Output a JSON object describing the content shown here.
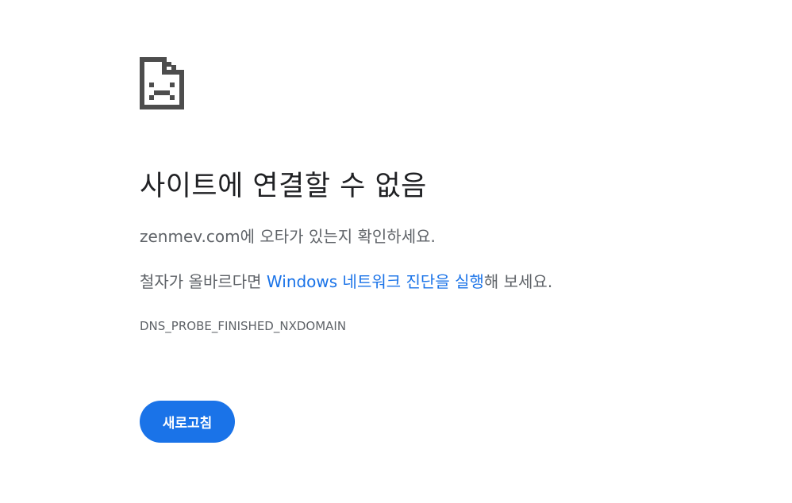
{
  "error": {
    "icon": "sad-page-icon",
    "title": "사이트에 연결할 수 없음",
    "domain": "zenmev.com",
    "domain_suffix": "에 오타가 있는지 확인하세요.",
    "hint_prefix": "철자가 올바르다면 ",
    "hint_link": "Windows 네트워크 진단을 실행",
    "hint_suffix": "해 보세요.",
    "code": "DNS_PROBE_FINISHED_NXDOMAIN"
  },
  "actions": {
    "reload_label": "새로고침"
  },
  "colors": {
    "accent": "#1a73e8",
    "title_text": "#202124",
    "body_text": "#5f6368",
    "icon": "#4d4d4d"
  }
}
